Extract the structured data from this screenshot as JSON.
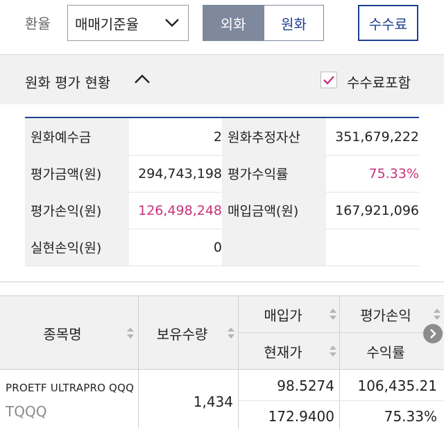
{
  "toolbar": {
    "rate_label": "환율",
    "rate_select_value": "매매기준율",
    "segment_fx": "외화",
    "segment_krw": "원화",
    "fee_button": "수수료"
  },
  "section": {
    "title": "원화 평가 현황",
    "fee_include_label": "수수료포함",
    "fee_include_checked": true
  },
  "summary": [
    {
      "label1": "원화예수금",
      "value1": "2",
      "label2": "원화추정자산",
      "value2": "351,679,222"
    },
    {
      "label1": "평가금액(원)",
      "value1": "294,743,198",
      "label2": "평가수익률",
      "value2": "75.33%"
    },
    {
      "label1": "평가손익(원)",
      "value1": "126,498,248",
      "label2": "매입금액(원)",
      "value2": "167,921,096"
    },
    {
      "label1": "실현손익(원)",
      "value1": "0",
      "label2": "",
      "value2": ""
    }
  ],
  "holdings": {
    "headers": {
      "name": "종목명",
      "quantity": "보유수량",
      "buy_price": "매입가",
      "current_price": "현재가",
      "eval_pl": "평가손익",
      "return_rate": "수익률"
    },
    "rows": [
      {
        "name": "PROETF ULTRAPRO QQQ",
        "code": "TQQQ",
        "quantity": "1,434",
        "buy_price": "98.5274",
        "current_price": "172.9400",
        "eval_pl": "106,435.21",
        "return_rate": "75.33%"
      }
    ]
  },
  "colors": {
    "navy": "#1f3f8f",
    "segment_active": "#7e899e",
    "positive_pink": "#c8327a",
    "header_gray": "#f1f1f1"
  }
}
